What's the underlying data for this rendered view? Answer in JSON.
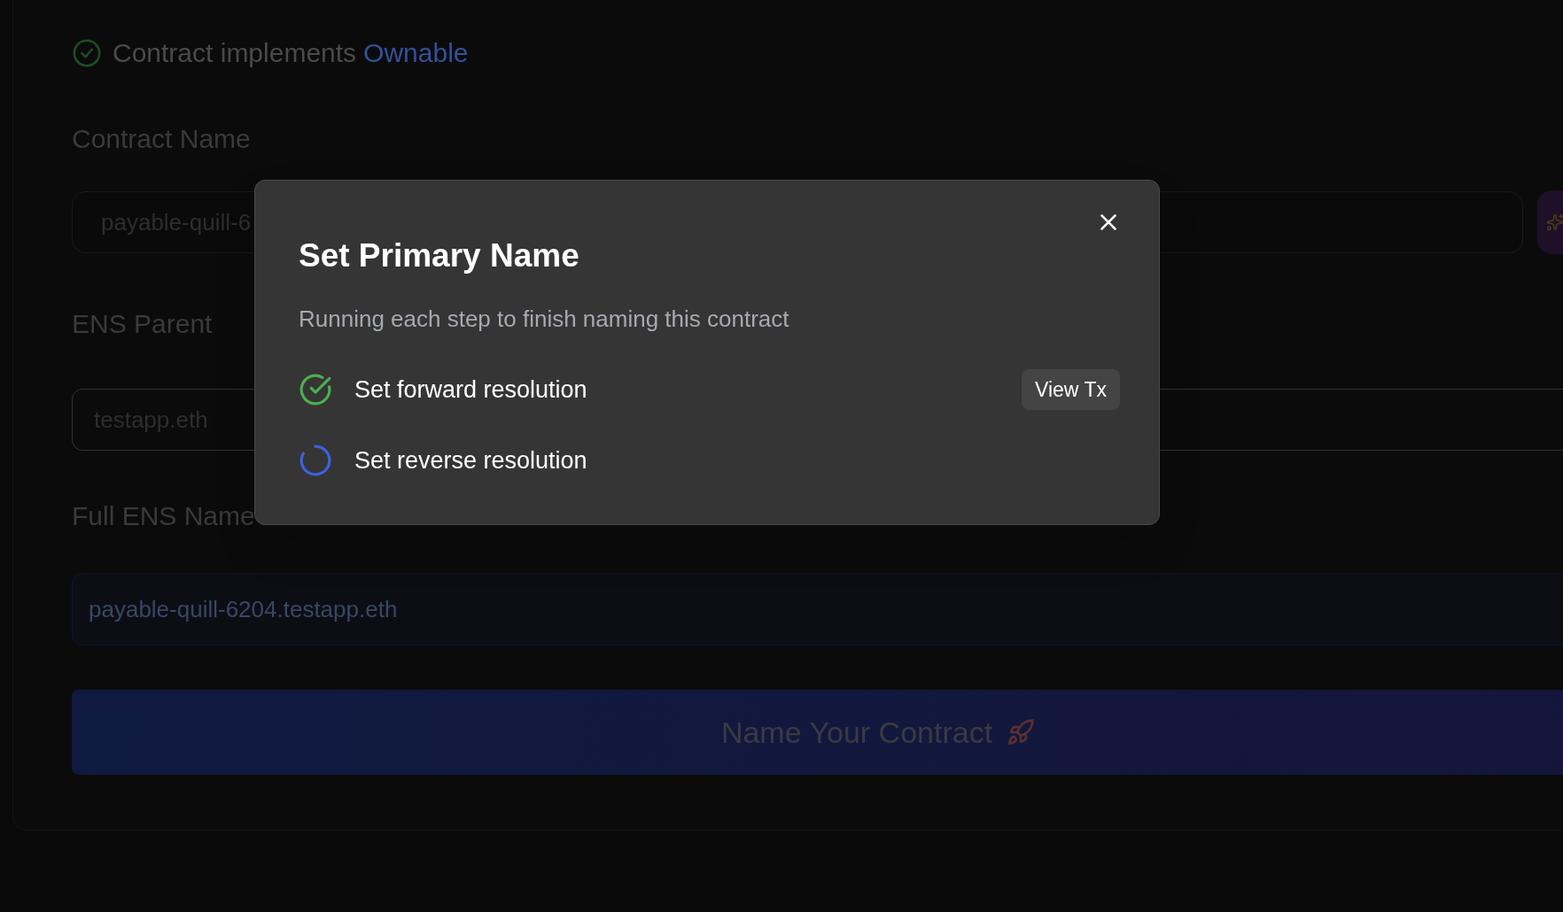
{
  "form": {
    "ownable_check": {
      "text": "Contract implements",
      "link": "Ownable"
    },
    "contract_name": {
      "label": "Contract Name",
      "value": "payable-quill-6"
    },
    "ens_parent": {
      "label": "ENS Parent",
      "value": "testapp.eth"
    },
    "full_ens_name": {
      "label": "Full ENS Name",
      "value": "payable-quill-6204.testapp.eth"
    },
    "submit": "Name Your Contract"
  },
  "dialog": {
    "title": "Set Primary Name",
    "description": "Running each step to finish naming this contract",
    "steps": [
      {
        "label": "Set forward resolution",
        "completed": true,
        "action": "View Tx"
      },
      {
        "label": "Set reverse resolution",
        "completed": false
      }
    ]
  }
}
